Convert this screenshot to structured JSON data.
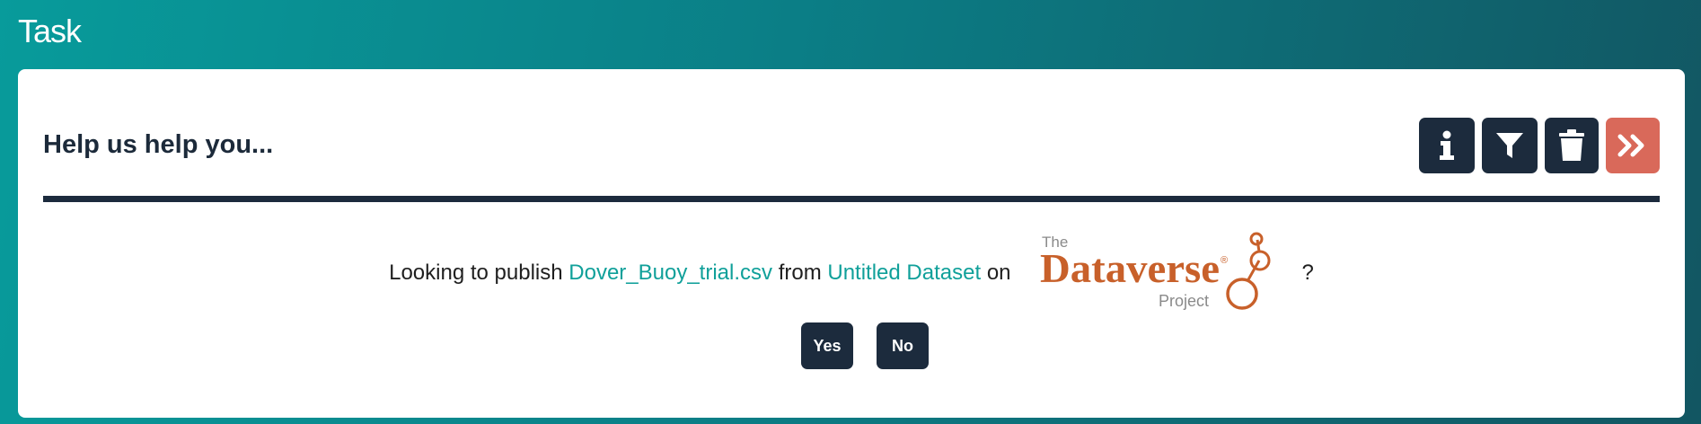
{
  "header": {
    "title": "Task"
  },
  "card": {
    "heading": "Help us help you...",
    "toolbar": [
      {
        "icon": "info-icon",
        "label": "Info"
      },
      {
        "icon": "filter-icon",
        "label": "Filter"
      },
      {
        "icon": "trash-icon",
        "label": "Delete"
      },
      {
        "icon": "double-chevron-right-icon",
        "label": "Skip"
      }
    ],
    "question": {
      "prefix": "Looking to publish",
      "file_name": "Dover_Buoy_trial.csv",
      "from_text": "from",
      "dataset_name": "Untitled Dataset",
      "on_text": "on",
      "logo_the": "The",
      "logo_main": "Dataverse",
      "logo_project": "Project",
      "suffix": "?"
    },
    "answers": {
      "yes": "Yes",
      "no": "No"
    }
  },
  "colors": {
    "accent": "#d9695a",
    "dark": "#1c2b3d",
    "link": "#10a09a",
    "logo": "#c8602a"
  }
}
